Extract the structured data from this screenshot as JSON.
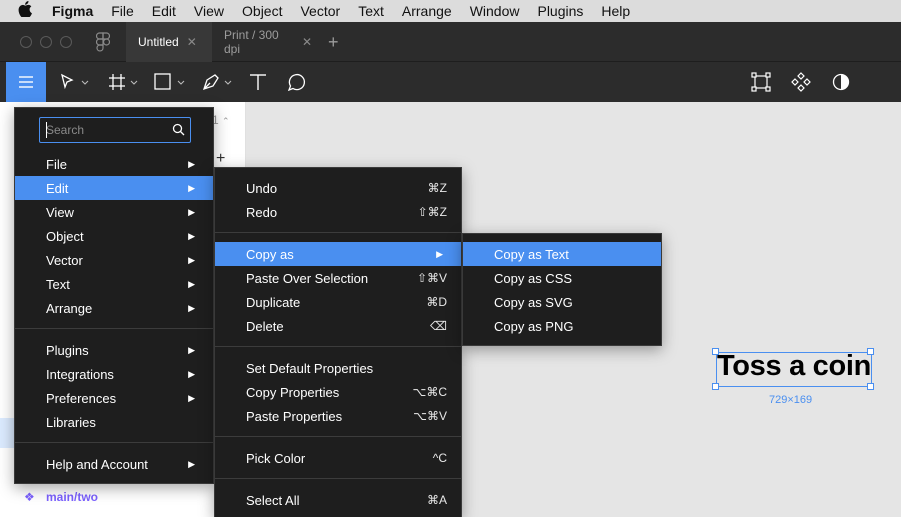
{
  "menubar": {
    "items": [
      "Figma",
      "File",
      "Edit",
      "View",
      "Object",
      "Vector",
      "Text",
      "Arrange",
      "Window",
      "Plugins",
      "Help"
    ]
  },
  "tabs": [
    {
      "label": "Untitled",
      "active": true
    },
    {
      "label": "Print / 300 dpi",
      "active": false
    }
  ],
  "left_panel": {
    "page_number": "1",
    "component_label": "main/two"
  },
  "main_menu": {
    "search_placeholder": "Search",
    "items": [
      {
        "label": "File",
        "submenu": true
      },
      {
        "label": "Edit",
        "submenu": true,
        "highlighted": true
      },
      {
        "label": "View",
        "submenu": true
      },
      {
        "label": "Object",
        "submenu": true
      },
      {
        "label": "Vector",
        "submenu": true
      },
      {
        "label": "Text",
        "submenu": true
      },
      {
        "label": "Arrange",
        "submenu": true
      },
      {
        "label": "Plugins",
        "submenu": true
      },
      {
        "label": "Integrations",
        "submenu": true
      },
      {
        "label": "Preferences",
        "submenu": true
      },
      {
        "label": "Libraries",
        "submenu": false
      },
      {
        "label": "Help and Account",
        "submenu": true
      }
    ]
  },
  "edit_menu": {
    "items": [
      {
        "label": "Undo",
        "shortcut": "⌘Z"
      },
      {
        "label": "Redo",
        "shortcut": "⇧⌘Z"
      },
      {
        "label": "Copy as",
        "submenu": true,
        "highlighted": true
      },
      {
        "label": "Paste Over Selection",
        "shortcut": "⇧⌘V"
      },
      {
        "label": "Duplicate",
        "shortcut": "⌘D"
      },
      {
        "label": "Delete",
        "shortcut": "⌫"
      },
      {
        "label": "Set Default Properties",
        "shortcut": ""
      },
      {
        "label": "Copy Properties",
        "shortcut": "⌥⌘C"
      },
      {
        "label": "Paste Properties",
        "shortcut": "⌥⌘V"
      },
      {
        "label": "Pick Color",
        "shortcut": "^C"
      },
      {
        "label": "Select All",
        "shortcut": "⌘A"
      }
    ]
  },
  "copy_as_menu": {
    "items": [
      {
        "label": "Copy as Text",
        "highlighted": true
      },
      {
        "label": "Copy as CSS"
      },
      {
        "label": "Copy as SVG"
      },
      {
        "label": "Copy as PNG"
      }
    ]
  },
  "canvas": {
    "text": "Toss a coin",
    "dimensions": "729×169"
  },
  "colors": {
    "accent": "#4a8ff0",
    "menu_bg": "#1e1e1e",
    "toolbar_bg": "#2c2c2c",
    "component": "#7b61ff"
  }
}
